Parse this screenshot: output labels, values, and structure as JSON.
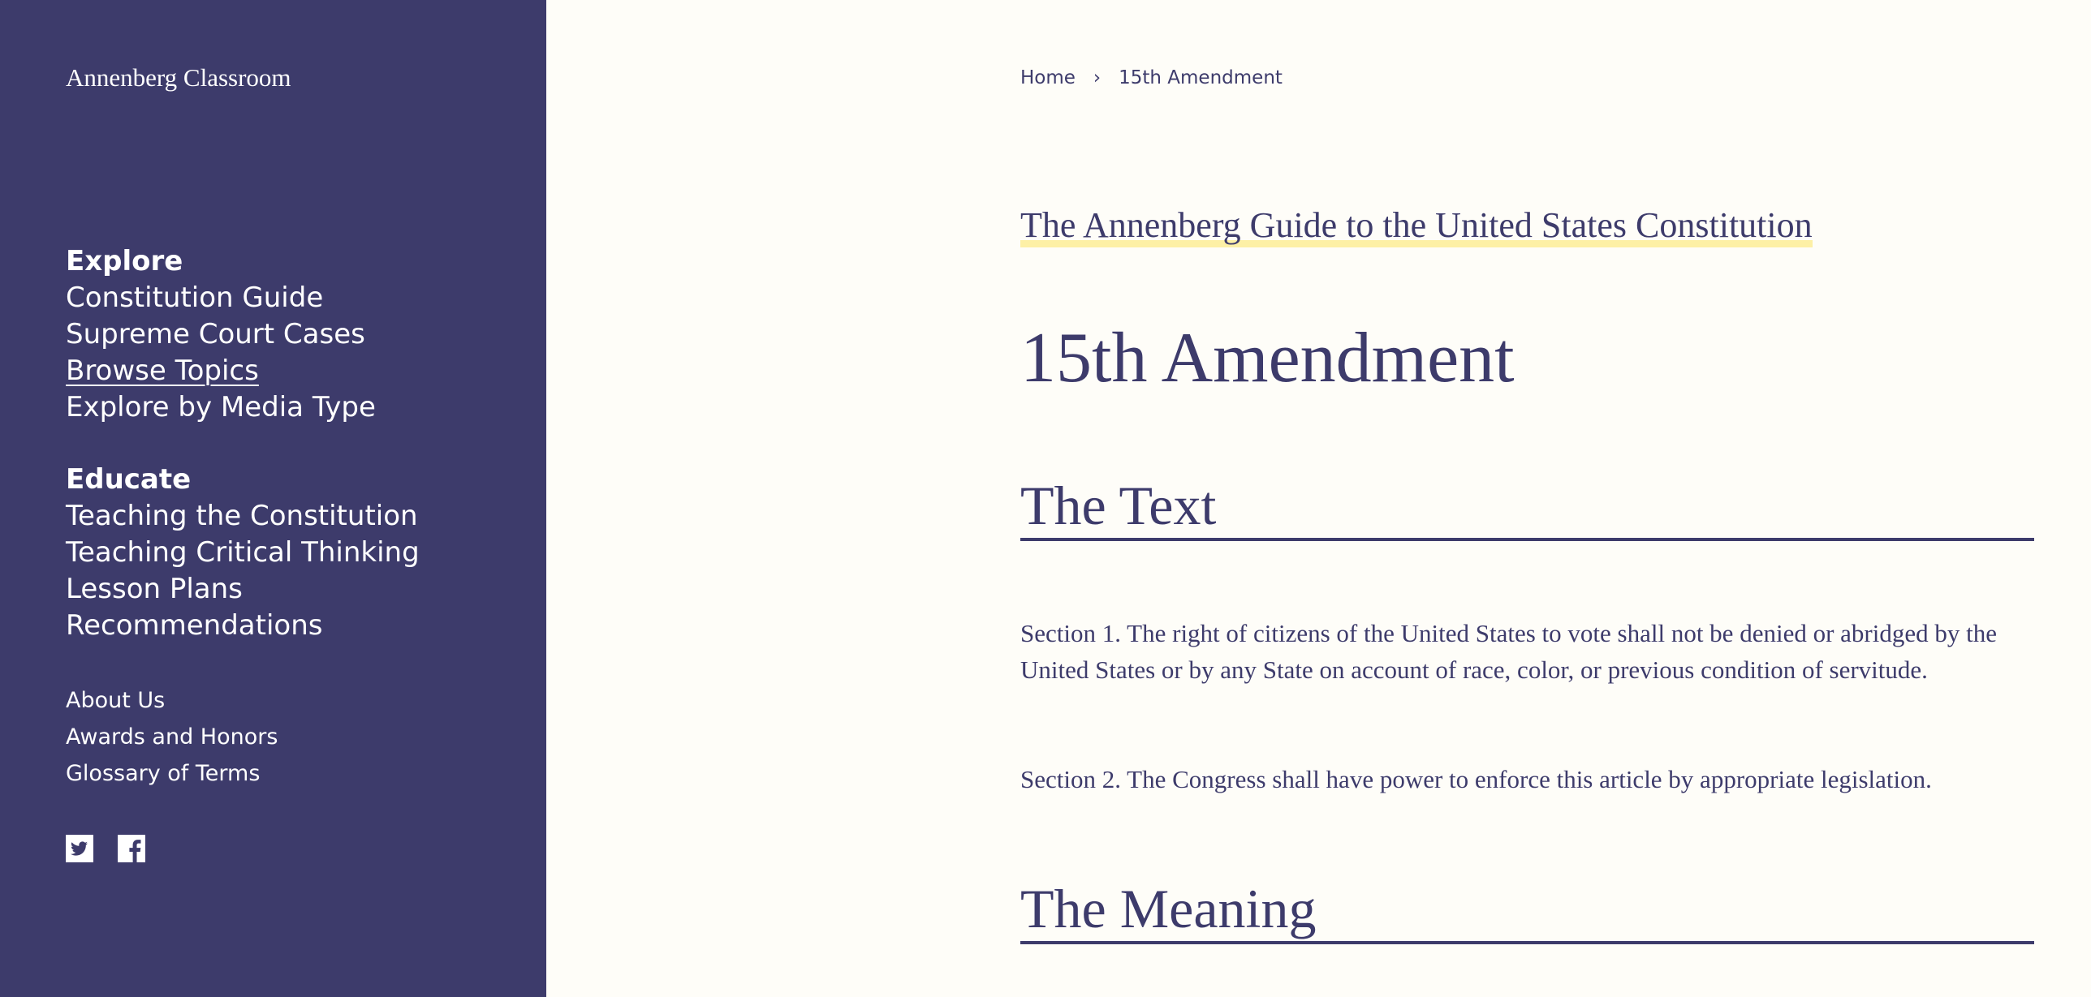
{
  "sidebar": {
    "brand": "Annenberg Classroom",
    "explore": {
      "title": "Explore",
      "items": [
        {
          "label": "Constitution Guide"
        },
        {
          "label": "Supreme Court Cases"
        },
        {
          "label": "Browse Topics"
        },
        {
          "label": "Explore by Media Type"
        }
      ]
    },
    "educate": {
      "title": "Educate",
      "items": [
        {
          "label": "Teaching the Constitution"
        },
        {
          "label": "Teaching Critical Thinking"
        },
        {
          "label": "Lesson Plans"
        },
        {
          "label": "Recommendations"
        }
      ]
    },
    "about": {
      "items": [
        {
          "label": "About Us"
        },
        {
          "label": "Awards and Honors"
        },
        {
          "label": "Glossary of Terms"
        }
      ]
    },
    "social": [
      "twitter-icon",
      "facebook-icon"
    ]
  },
  "breadcrumb": {
    "home": "Home",
    "separator": "›",
    "current": "15th Amendment"
  },
  "main": {
    "guide_title": "The Annenberg Guide to the United States Constitution",
    "page_title": "15th Amendment",
    "section_text_heading": "The Text",
    "paragraphs": [
      "Section 1. The right of citizens of the United States to vote shall not be denied or abridged by the United States or by any State on account of race, color, or previous condition of servitude.",
      "Section 2. The Congress shall have power to enforce this article by appropriate legislation."
    ],
    "section_meaning_heading": "The Meaning"
  },
  "colors": {
    "sidebar_bg": "#3d3b6b",
    "page_bg": "#fefdf8",
    "text": "#3d3b6b",
    "highlight": "#fdf0a6"
  }
}
